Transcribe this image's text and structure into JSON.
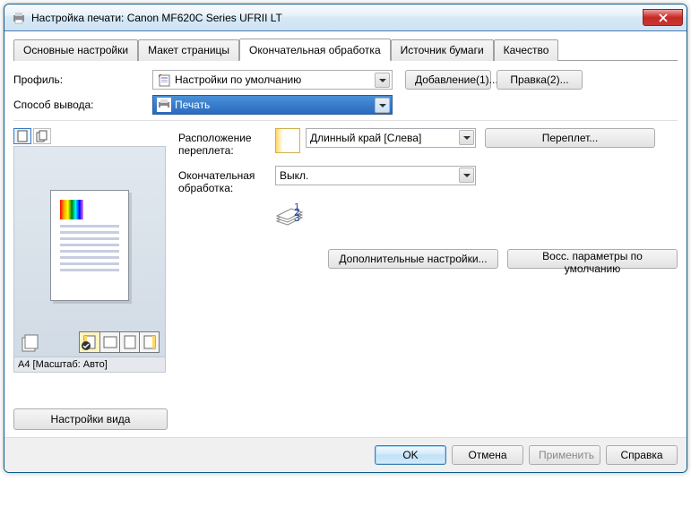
{
  "window": {
    "title": "Настройка печати: Canon MF620C Series UFRII LT"
  },
  "tabs": [
    "Основные настройки",
    "Макет страницы",
    "Окончательная обработка",
    "Источник бумаги",
    "Качество"
  ],
  "active_tab": 2,
  "profile": {
    "label": "Профиль:",
    "value": "Настройки по умолчанию",
    "add_button": "Добавление(1)...",
    "edit_button": "Правка(2)..."
  },
  "output": {
    "label": "Способ вывода:",
    "value": "Печать"
  },
  "preview": {
    "caption": "A4 [Масштаб: Авто]",
    "view_settings_button": "Настройки вида"
  },
  "settings": {
    "binding": {
      "label": "Расположение переплета:",
      "value": "Длинный край [Слева]",
      "button": "Переплет..."
    },
    "finishing": {
      "label": "Окончательная обработка:",
      "value": "Выкл."
    }
  },
  "footer": {
    "advanced_button": "Дополнительные настройки...",
    "restore_button": "Восс. параметры по умолчанию"
  },
  "dialog": {
    "ok": "OK",
    "cancel": "Отмена",
    "apply": "Применить",
    "help": "Справка"
  }
}
